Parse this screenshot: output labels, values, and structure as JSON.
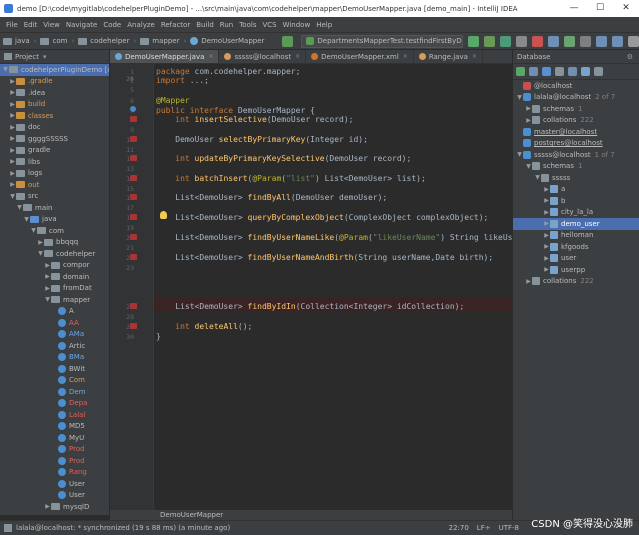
{
  "window": {
    "title": "demo [D:\\code\\mygitlab\\codehelperPluginDemo] - ...\\src\\main\\java\\com\\codehelper\\mapper\\DemoUserMapper.java [demo_main] - IntelliJ IDEA",
    "controls": [
      "—",
      "☐",
      "✕"
    ]
  },
  "menu": [
    "File",
    "Edit",
    "View",
    "Navigate",
    "Code",
    "Analyze",
    "Refactor",
    "Build",
    "Run",
    "Tools",
    "VCS",
    "Window",
    "Help"
  ],
  "breadcrumbs": [
    "java",
    "com",
    "codehelper",
    "mapper",
    "DemoUserMapper"
  ],
  "run_config": "DepartmentsMapperTest.testfindFirstByDepartmentId",
  "project_panel": {
    "title": "Project",
    "root": "codehelperPluginDemo [code",
    "items": [
      {
        "label": ".gradle",
        "indent": 1,
        "arrow": "▶",
        "icon": "orange",
        "color": "orange"
      },
      {
        "label": ".idea",
        "indent": 1,
        "arrow": "▶",
        "icon": "gray",
        "color": ""
      },
      {
        "label": "build",
        "indent": 1,
        "arrow": "▶",
        "icon": "orange",
        "color": "orange"
      },
      {
        "label": "classes",
        "indent": 1,
        "arrow": "▶",
        "icon": "orange",
        "color": "orange"
      },
      {
        "label": "doc",
        "indent": 1,
        "arrow": "▶",
        "icon": "gray",
        "color": ""
      },
      {
        "label": "ggggSSSSS",
        "indent": 1,
        "arrow": "▶",
        "icon": "gray",
        "color": ""
      },
      {
        "label": "gradle",
        "indent": 1,
        "arrow": "▶",
        "icon": "gray",
        "color": ""
      },
      {
        "label": "libs",
        "indent": 1,
        "arrow": "▶",
        "icon": "gray",
        "color": ""
      },
      {
        "label": "logs",
        "indent": 1,
        "arrow": "▶",
        "icon": "gray",
        "color": ""
      },
      {
        "label": "out",
        "indent": 1,
        "arrow": "▶",
        "icon": "orange",
        "color": "orange"
      },
      {
        "label": "src",
        "indent": 1,
        "arrow": "▼",
        "icon": "gray",
        "color": ""
      },
      {
        "label": "main",
        "indent": 2,
        "arrow": "▼",
        "icon": "gray",
        "color": ""
      },
      {
        "label": "java",
        "indent": 3,
        "arrow": "▼",
        "icon": "blue",
        "color": ""
      },
      {
        "label": "com",
        "indent": 4,
        "arrow": "▼",
        "icon": "gray",
        "color": ""
      },
      {
        "label": "bbqqq",
        "indent": 5,
        "arrow": "▶",
        "icon": "gray",
        "color": ""
      },
      {
        "label": "codehelper",
        "indent": 5,
        "arrow": "▼",
        "icon": "gray",
        "color": ""
      },
      {
        "label": "compor",
        "indent": 6,
        "arrow": "▶",
        "icon": "gray",
        "color": ""
      },
      {
        "label": "domain",
        "indent": 6,
        "arrow": "▶",
        "icon": "gray",
        "color": ""
      },
      {
        "label": "fromDat",
        "indent": 6,
        "arrow": "▶",
        "icon": "gray",
        "color": ""
      },
      {
        "label": "mapper",
        "indent": 6,
        "arrow": "▼",
        "icon": "gray",
        "color": ""
      },
      {
        "label": "A",
        "indent": 7,
        "arrow": "",
        "icon": "circle-blue",
        "color": ""
      },
      {
        "label": "AA",
        "indent": 7,
        "arrow": "",
        "icon": "circle-blue",
        "color": "red"
      },
      {
        "label": "AMa",
        "indent": 7,
        "arrow": "",
        "icon": "circle-blue",
        "color": "blue"
      },
      {
        "label": "Artic",
        "indent": 7,
        "arrow": "",
        "icon": "circle-blue",
        "color": ""
      },
      {
        "label": "BMa",
        "indent": 7,
        "arrow": "",
        "icon": "circle-blue",
        "color": "blue"
      },
      {
        "label": "BWit",
        "indent": 7,
        "arrow": "",
        "icon": "circle-blue",
        "color": ""
      },
      {
        "label": "Com",
        "indent": 7,
        "arrow": "",
        "icon": "circle-blue",
        "color": "orange"
      },
      {
        "label": "Dem",
        "indent": 7,
        "arrow": "",
        "icon": "circle-blue",
        "color": "blue"
      },
      {
        "label": "Depa",
        "indent": 7,
        "arrow": "",
        "icon": "circle-blue",
        "color": "red"
      },
      {
        "label": "Lalal",
        "indent": 7,
        "arrow": "",
        "icon": "circle-blue",
        "color": "red"
      },
      {
        "label": "MD5",
        "indent": 7,
        "arrow": "",
        "icon": "circle-blue",
        "color": ""
      },
      {
        "label": "MyU",
        "indent": 7,
        "arrow": "",
        "icon": "circle-blue",
        "color": ""
      },
      {
        "label": "Prod",
        "indent": 7,
        "arrow": "",
        "icon": "circle-blue",
        "color": "red"
      },
      {
        "label": "Prod",
        "indent": 7,
        "arrow": "",
        "icon": "circle-blue",
        "color": "red"
      },
      {
        "label": "Rang",
        "indent": 7,
        "arrow": "",
        "icon": "circle-blue",
        "color": "red"
      },
      {
        "label": "User",
        "indent": 7,
        "arrow": "",
        "icon": "circle-blue",
        "color": ""
      },
      {
        "label": "User",
        "indent": 7,
        "arrow": "",
        "icon": "circle-blue",
        "color": ""
      },
      {
        "label": "mysqlD",
        "indent": 6,
        "arrow": "▶",
        "icon": "gray",
        "color": ""
      }
    ]
  },
  "tabs": [
    {
      "label": "DemoUserMapper.java",
      "active": true,
      "icon": "#6fa7d3"
    },
    {
      "label": "sssss@localhost",
      "active": false,
      "icon": "#d69c58"
    },
    {
      "label": "DemoUserMapper.xml",
      "active": false,
      "icon": "#d0732b"
    },
    {
      "label": "Range.java",
      "active": false,
      "icon": "#d69c58"
    }
  ],
  "code_lines": [
    {
      "n": "1",
      "html": "<span class=\"kw\">package</span> com.codehelper.mapper;"
    },
    {
      "n": "2",
      "html": "<span class=\"kw\">import</span> ...;"
    },
    {
      "n": "5",
      "html": ""
    },
    {
      "n": "6",
      "html": "<span class=\"ann\">@Mapper</span>"
    },
    {
      "n": "7",
      "html": "<span class=\"kw\">public interface</span> DemoUserMapper {"
    },
    {
      "n": "8",
      "html": "    <span class=\"kw\">int</span> <span class=\"fn\">insertSelective</span>(DemoUser record);"
    },
    {
      "n": "9",
      "html": ""
    },
    {
      "n": "10",
      "html": "    DemoUser <span class=\"fn\">selectByPrimaryKey</span>(Integer id);"
    },
    {
      "n": "11",
      "html": ""
    },
    {
      "n": "12",
      "html": "    <span class=\"kw\">int</span> <span class=\"fn\">updateByPrimaryKeySelective</span>(DemoUser record);"
    },
    {
      "n": "13",
      "html": ""
    },
    {
      "n": "14",
      "html": "    <span class=\"kw\">int</span> <span class=\"fn\">batchInsert</span>(<span class=\"ann\">@Param</span>(<span class=\"str\">\"list\"</span>) List&lt;DemoUser&gt; list);"
    },
    {
      "n": "15",
      "html": ""
    },
    {
      "n": "16",
      "html": "    List&lt;DemoUser&gt; <span class=\"fn\">findByAll</span>(DemoUser demoUser);"
    },
    {
      "n": "17",
      "html": ""
    },
    {
      "n": "18",
      "html": "    List&lt;DemoUser&gt; <span class=\"fn\">queryByComplexObject</span>(ComplexObject complexObject);"
    },
    {
      "n": "19",
      "html": ""
    },
    {
      "n": "20",
      "html": "    List&lt;DemoUser&gt; <span class=\"fn\">findByUserNameLike</span>(<span class=\"ann\">@Param</span>(<span class=\"str\">\"likeUserName\"</span>) String likeUserNa"
    },
    {
      "n": "21",
      "html": ""
    },
    {
      "n": "22",
      "html": "    List&lt;DemoUser&gt; <span class=\"fn\">findByUserNameAndBirth</span>(String userName,Date birth);"
    },
    {
      "n": "23",
      "html": ""
    },
    {
      "n": "24",
      "html": ""
    },
    {
      "n": "25",
      "html": ""
    },
    {
      "n": "26",
      "html": ""
    },
    {
      "n": "27",
      "html": "    List&lt;DemoUser&gt; <span class=\"fn\">findByIdIn</span>(Collection&lt;Integer&gt; idCollection);"
    },
    {
      "n": "28",
      "html": ""
    },
    {
      "n": "29",
      "html": "    <span class=\"kw\">int</span> <span class=\"fn\">deleteAll</span>();"
    },
    {
      "n": "30",
      "html": "}"
    }
  ],
  "editor_breadcrumb": "DemoUserMapper",
  "database_panel": {
    "title": "Database",
    "items": [
      {
        "label": "@localhost",
        "indent": 0,
        "arrow": "",
        "icon": "dbred",
        "count": "",
        "sel": false,
        "underline": false
      },
      {
        "label": "lalala@localhost",
        "indent": 0,
        "arrow": "▼",
        "icon": "db",
        "count": "2 of 7",
        "sel": false,
        "underline": false
      },
      {
        "label": "schemas",
        "indent": 1,
        "arrow": "▶",
        "icon": "schema",
        "count": "1",
        "sel": false,
        "underline": false
      },
      {
        "label": "collations",
        "indent": 1,
        "arrow": "▶",
        "icon": "schema",
        "count": "222",
        "sel": false,
        "underline": false
      },
      {
        "label": "master@localhost",
        "indent": 0,
        "arrow": "",
        "icon": "db",
        "count": "",
        "sel": false,
        "underline": true
      },
      {
        "label": "postgres@localhost",
        "indent": 0,
        "arrow": "",
        "icon": "db",
        "count": "",
        "sel": false,
        "underline": true
      },
      {
        "label": "sssss@localhost",
        "indent": 0,
        "arrow": "▼",
        "icon": "db",
        "count": "1 of 7",
        "sel": false,
        "underline": false
      },
      {
        "label": "schemas",
        "indent": 1,
        "arrow": "▼",
        "icon": "schema",
        "count": "1",
        "sel": false,
        "underline": false
      },
      {
        "label": "sssss",
        "indent": 2,
        "arrow": "▼",
        "icon": "schema",
        "count": "",
        "sel": false,
        "underline": false
      },
      {
        "label": "a",
        "indent": 3,
        "arrow": "▶",
        "icon": "table",
        "count": "",
        "sel": false,
        "underline": false
      },
      {
        "label": "b",
        "indent": 3,
        "arrow": "▶",
        "icon": "table",
        "count": "",
        "sel": false,
        "underline": false
      },
      {
        "label": "city_la_la",
        "indent": 3,
        "arrow": "▶",
        "icon": "table",
        "count": "",
        "sel": false,
        "underline": false
      },
      {
        "label": "demo_user",
        "indent": 3,
        "arrow": "▶",
        "icon": "table",
        "count": "",
        "sel": true,
        "underline": false
      },
      {
        "label": "helloman",
        "indent": 3,
        "arrow": "▶",
        "icon": "table",
        "count": "",
        "sel": false,
        "underline": false
      },
      {
        "label": "kfgoods",
        "indent": 3,
        "arrow": "▶",
        "icon": "table",
        "count": "",
        "sel": false,
        "underline": false
      },
      {
        "label": "user",
        "indent": 3,
        "arrow": "▶",
        "icon": "table",
        "count": "",
        "sel": false,
        "underline": false
      },
      {
        "label": "userpp",
        "indent": 3,
        "arrow": "▶",
        "icon": "table",
        "count": "",
        "sel": false,
        "underline": false
      },
      {
        "label": "collations",
        "indent": 1,
        "arrow": "▶",
        "icon": "schema",
        "count": "222",
        "sel": false,
        "underline": false
      }
    ]
  },
  "status": {
    "message": "lalala@localhost: * synchronized (19 s 88 ms) (a minute ago)",
    "position": "22:70",
    "line_sep": "LF÷",
    "encoding": "UTF-8"
  },
  "watermark": "CSDN @笑得没心没肺"
}
